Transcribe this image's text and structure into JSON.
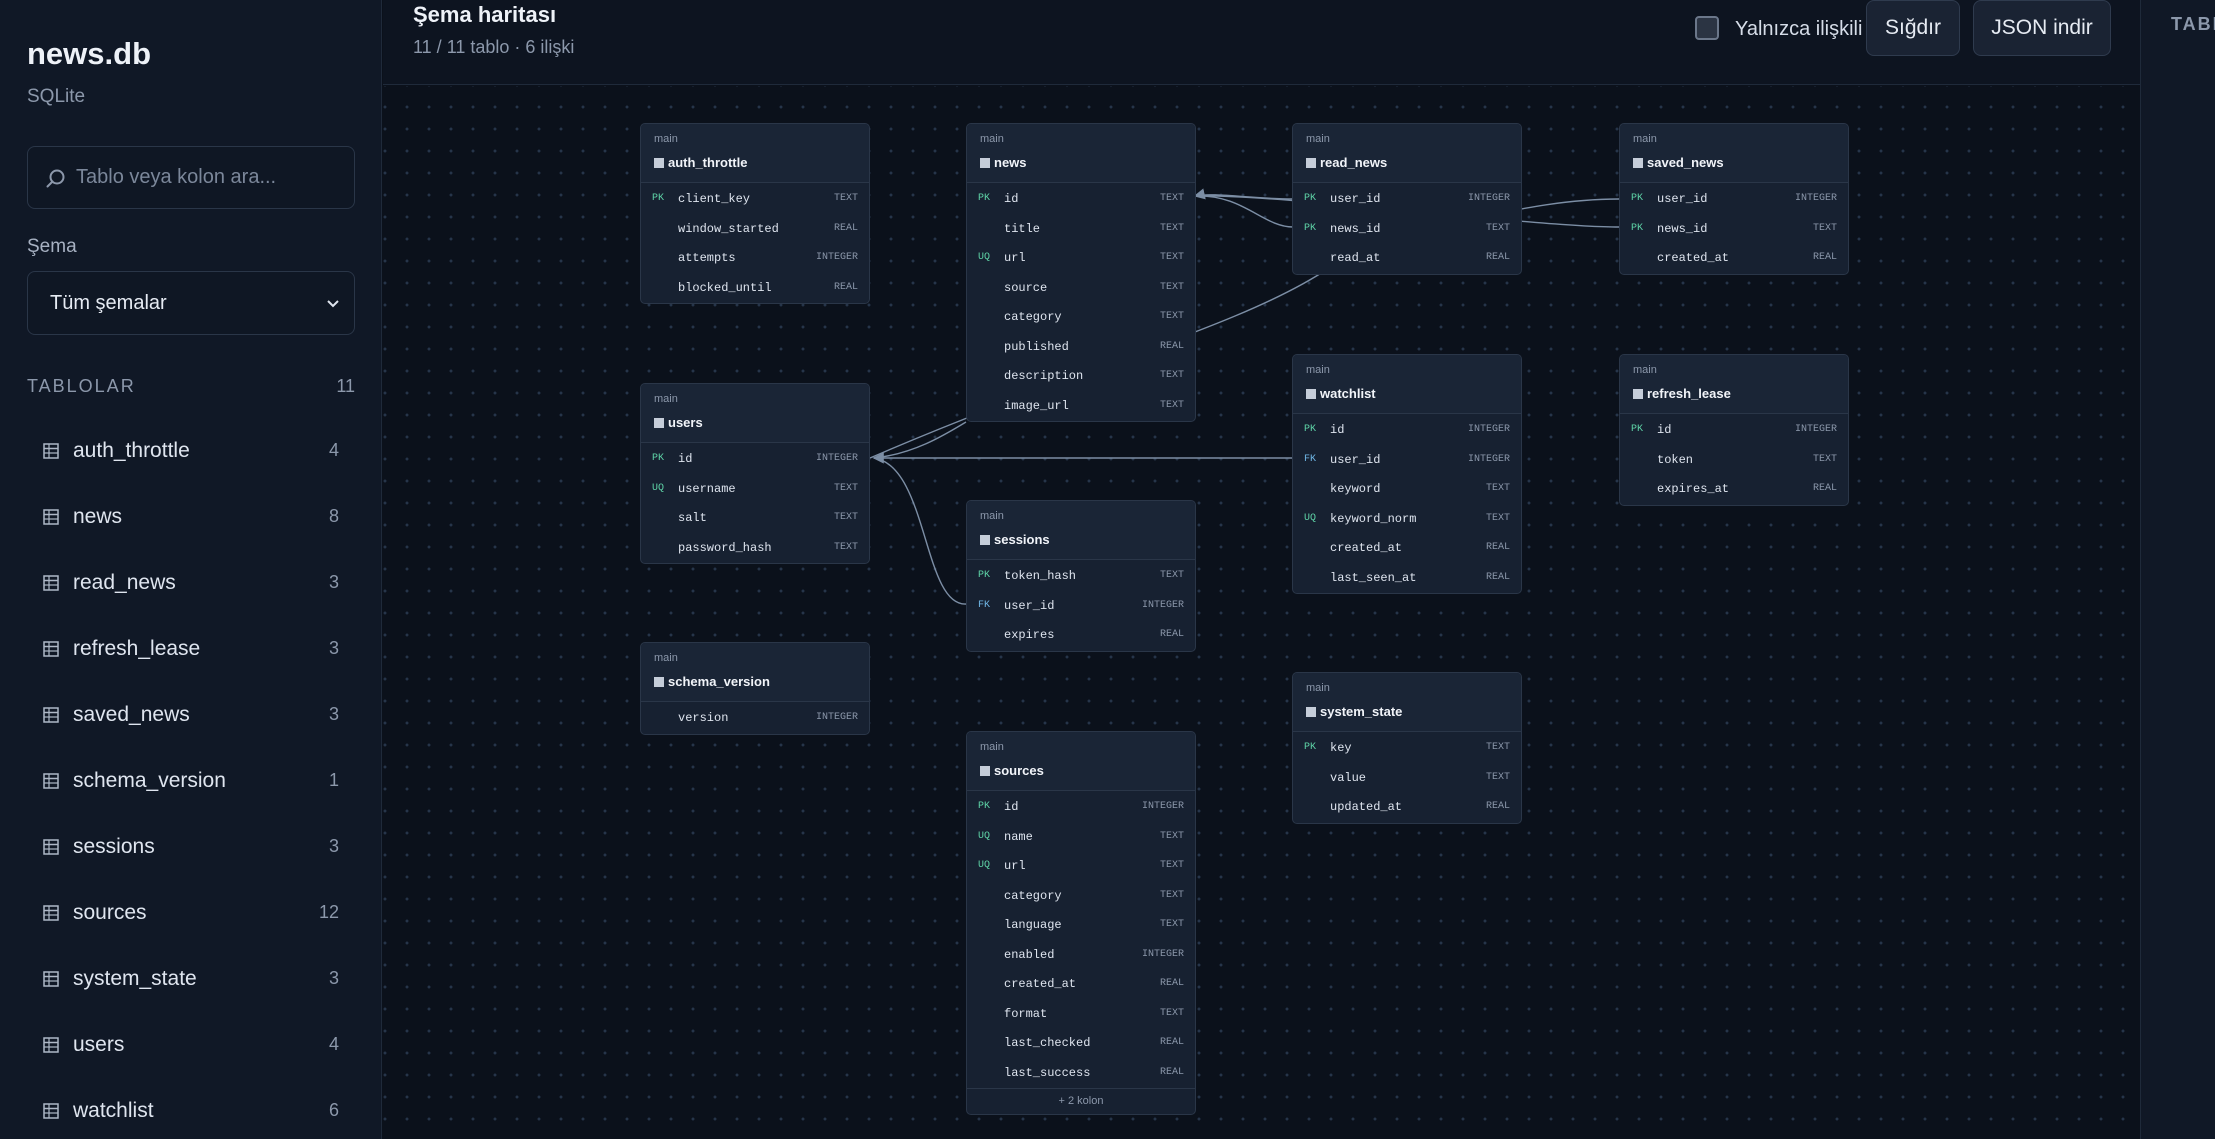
{
  "sidebar": {
    "db_name": "news.db",
    "db_engine": "SQLite",
    "search_placeholder": "Tablo veya kolon ara...",
    "schema_label": "Şema",
    "schema_value": "Tüm şemalar",
    "tables_title": "TABLOLAR",
    "tables_count": "11",
    "tables": [
      {
        "name": "auth_throttle",
        "count": "4"
      },
      {
        "name": "news",
        "count": "8"
      },
      {
        "name": "read_news",
        "count": "3"
      },
      {
        "name": "refresh_lease",
        "count": "3"
      },
      {
        "name": "saved_news",
        "count": "3"
      },
      {
        "name": "schema_version",
        "count": "1"
      },
      {
        "name": "sessions",
        "count": "3"
      },
      {
        "name": "sources",
        "count": "12"
      },
      {
        "name": "system_state",
        "count": "3"
      },
      {
        "name": "users",
        "count": "4"
      },
      {
        "name": "watchlist",
        "count": "6"
      }
    ]
  },
  "header": {
    "title": "Şema haritası",
    "subtitle": "11 / 11 tablo · 6 ilişki",
    "related_only_label": "Yalnızca ilişkili",
    "related_only_checked": false,
    "fit_label": "Sığdır",
    "json_label": "JSON indir"
  },
  "right_panel": {
    "label": "TABLO"
  },
  "colors": {
    "pk": "#5fd5a8",
    "fk": "#71b8e8",
    "edge": "#7c8ea5"
  },
  "canvas": {
    "tables": [
      {
        "id": "auth_throttle",
        "schema": "main",
        "name": "auth_throttle",
        "columns": [
          {
            "key": "PK",
            "name": "client_key",
            "type": "TEXT"
          },
          {
            "key": "",
            "name": "window_started",
            "type": "REAL"
          },
          {
            "key": "",
            "name": "attempts",
            "type": "INTEGER"
          },
          {
            "key": "",
            "name": "blocked_until",
            "type": "REAL"
          }
        ]
      },
      {
        "id": "news",
        "schema": "main",
        "name": "news",
        "columns": [
          {
            "key": "PK",
            "name": "id",
            "type": "TEXT"
          },
          {
            "key": "",
            "name": "title",
            "type": "TEXT"
          },
          {
            "key": "UQ",
            "name": "url",
            "type": "TEXT"
          },
          {
            "key": "",
            "name": "source",
            "type": "TEXT"
          },
          {
            "key": "",
            "name": "category",
            "type": "TEXT"
          },
          {
            "key": "",
            "name": "published",
            "type": "REAL"
          },
          {
            "key": "",
            "name": "description",
            "type": "TEXT"
          },
          {
            "key": "",
            "name": "image_url",
            "type": "TEXT"
          }
        ]
      },
      {
        "id": "read_news",
        "schema": "main",
        "name": "read_news",
        "columns": [
          {
            "key": "PK",
            "name": "user_id",
            "type": "INTEGER"
          },
          {
            "key": "PK",
            "name": "news_id",
            "type": "TEXT"
          },
          {
            "key": "",
            "name": "read_at",
            "type": "REAL"
          }
        ]
      },
      {
        "id": "saved_news",
        "schema": "main",
        "name": "saved_news",
        "columns": [
          {
            "key": "PK",
            "name": "user_id",
            "type": "INTEGER"
          },
          {
            "key": "PK",
            "name": "news_id",
            "type": "TEXT"
          },
          {
            "key": "",
            "name": "created_at",
            "type": "REAL"
          }
        ]
      },
      {
        "id": "users",
        "schema": "main",
        "name": "users",
        "columns": [
          {
            "key": "PK",
            "name": "id",
            "type": "INTEGER"
          },
          {
            "key": "UQ",
            "name": "username",
            "type": "TEXT"
          },
          {
            "key": "",
            "name": "salt",
            "type": "TEXT"
          },
          {
            "key": "",
            "name": "password_hash",
            "type": "TEXT"
          }
        ]
      },
      {
        "id": "watchlist",
        "schema": "main",
        "name": "watchlist",
        "columns": [
          {
            "key": "PK",
            "name": "id",
            "type": "INTEGER"
          },
          {
            "key": "FK",
            "name": "user_id",
            "type": "INTEGER"
          },
          {
            "key": "",
            "name": "keyword",
            "type": "TEXT"
          },
          {
            "key": "UQ",
            "name": "keyword_norm",
            "type": "TEXT"
          },
          {
            "key": "",
            "name": "created_at",
            "type": "REAL"
          },
          {
            "key": "",
            "name": "last_seen_at",
            "type": "REAL"
          }
        ]
      },
      {
        "id": "refresh_lease",
        "schema": "main",
        "name": "refresh_lease",
        "columns": [
          {
            "key": "PK",
            "name": "id",
            "type": "INTEGER"
          },
          {
            "key": "",
            "name": "token",
            "type": "TEXT"
          },
          {
            "key": "",
            "name": "expires_at",
            "type": "REAL"
          }
        ]
      },
      {
        "id": "sessions",
        "schema": "main",
        "name": "sessions",
        "columns": [
          {
            "key": "PK",
            "name": "token_hash",
            "type": "TEXT"
          },
          {
            "key": "FK",
            "name": "user_id",
            "type": "INTEGER"
          },
          {
            "key": "",
            "name": "expires",
            "type": "REAL"
          }
        ]
      },
      {
        "id": "schema_version",
        "schema": "main",
        "name": "schema_version",
        "columns": [
          {
            "key": "",
            "name": "version",
            "type": "INTEGER"
          }
        ]
      },
      {
        "id": "system_state",
        "schema": "main",
        "name": "system_state",
        "columns": [
          {
            "key": "PK",
            "name": "key",
            "type": "TEXT"
          },
          {
            "key": "",
            "name": "value",
            "type": "TEXT"
          },
          {
            "key": "",
            "name": "updated_at",
            "type": "REAL"
          }
        ]
      },
      {
        "id": "sources",
        "schema": "main",
        "name": "sources",
        "more_label": "+ 2 kolon",
        "columns": [
          {
            "key": "PK",
            "name": "id",
            "type": "INTEGER"
          },
          {
            "key": "UQ",
            "name": "name",
            "type": "TEXT"
          },
          {
            "key": "UQ",
            "name": "url",
            "type": "TEXT"
          },
          {
            "key": "",
            "name": "category",
            "type": "TEXT"
          },
          {
            "key": "",
            "name": "language",
            "type": "TEXT"
          },
          {
            "key": "",
            "name": "enabled",
            "type": "INTEGER"
          },
          {
            "key": "",
            "name": "created_at",
            "type": "REAL"
          },
          {
            "key": "",
            "name": "format",
            "type": "TEXT"
          },
          {
            "key": "",
            "name": "last_checked",
            "type": "REAL"
          },
          {
            "key": "",
            "name": "last_success",
            "type": "REAL"
          }
        ]
      }
    ]
  }
}
